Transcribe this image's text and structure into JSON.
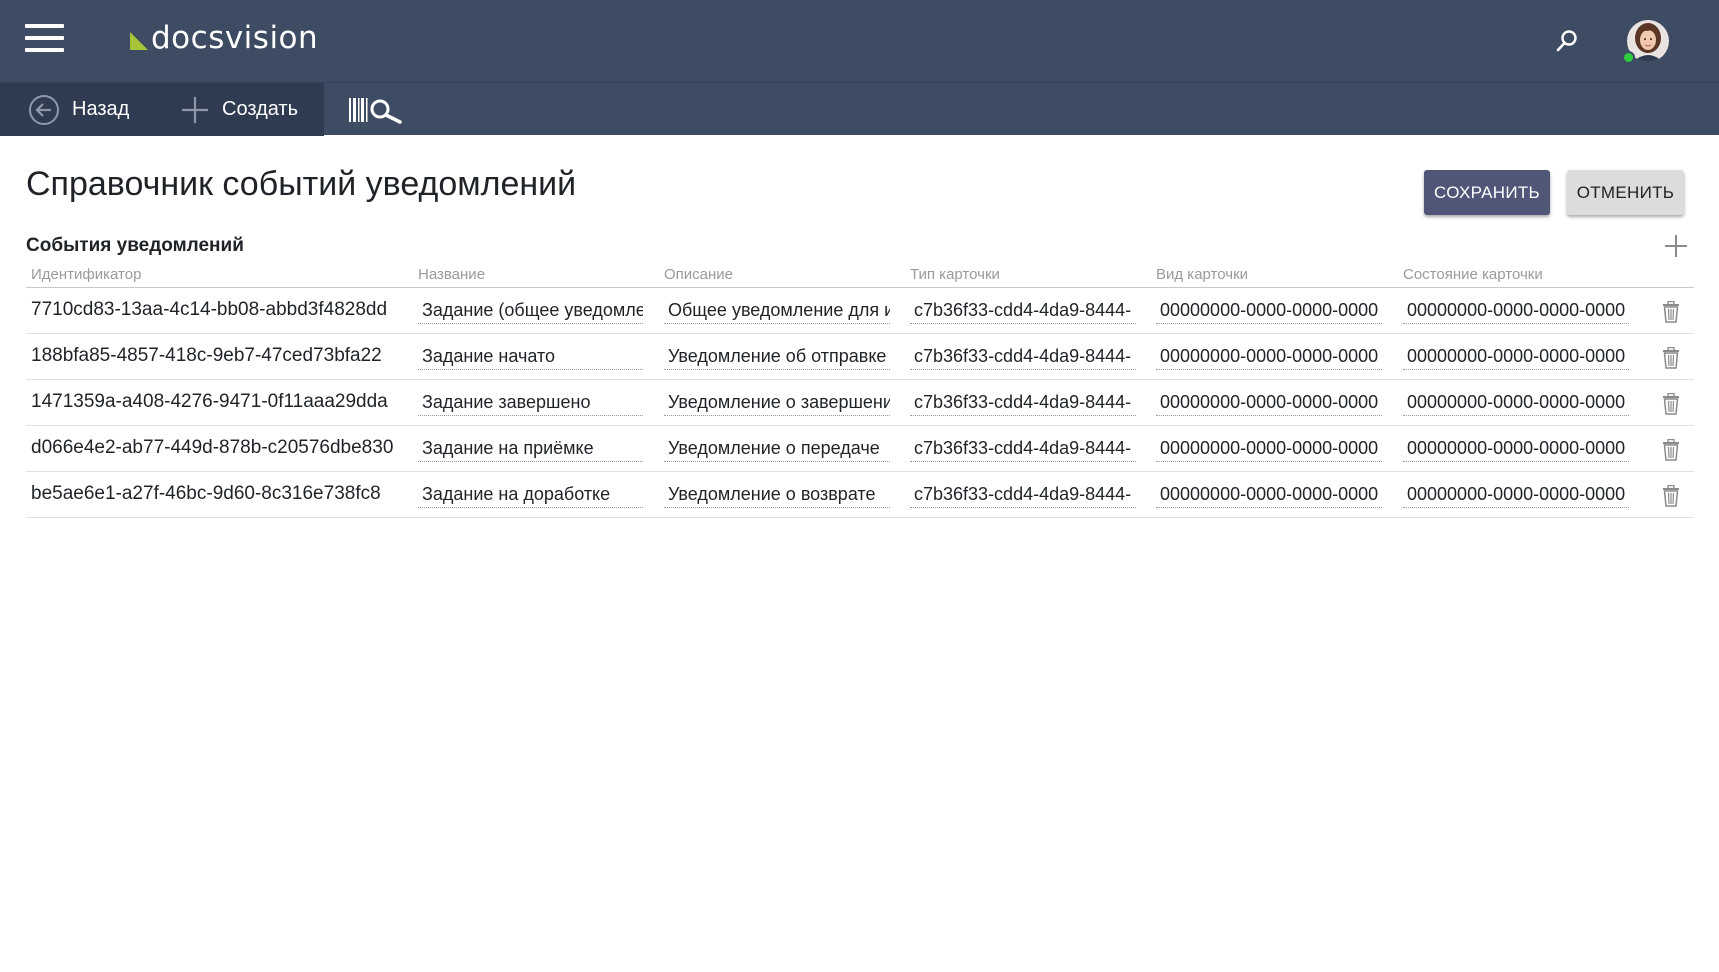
{
  "header": {
    "logo_text": "docsvision",
    "brand_color": "#a6c43a",
    "icons": [
      "menu-icon",
      "search-icon",
      "avatar"
    ]
  },
  "toolbar": {
    "back_label": "Назад",
    "create_label": "Создать",
    "barcode_icon": "barcode-search-icon"
  },
  "page": {
    "title": "Справочник событий уведомлений",
    "save_label": "СОХРАНИТЬ",
    "cancel_label": "ОТМЕНИТЬ"
  },
  "section": {
    "title": "События уведомлений"
  },
  "table": {
    "columns": [
      "Идентификатор",
      "Название",
      "Описание",
      "Тип карточки",
      "Вид карточки",
      "Состояние карточки"
    ],
    "rows": [
      {
        "id": "7710cd83-13aa-4c14-bb08-abbd3f4828dd",
        "name": "Задание (общее уведомление)",
        "description": "Общее уведомление для исполнителя",
        "card_type": "c7b36f33-cdd4-4da9-8444-",
        "card_kind": "00000000-0000-0000-0000",
        "card_state": "00000000-0000-0000-0000"
      },
      {
        "id": "188bfa85-4857-418c-9eb7-47ced73bfa22",
        "name": "Задание начато",
        "description": "Уведомление об отправке",
        "card_type": "c7b36f33-cdd4-4da9-8444-",
        "card_kind": "00000000-0000-0000-0000",
        "card_state": "00000000-0000-0000-0000"
      },
      {
        "id": "1471359a-a408-4276-9471-0f11aaa29dda",
        "name": "Задание завершено",
        "description": "Уведомление о завершении",
        "card_type": "c7b36f33-cdd4-4da9-8444-",
        "card_kind": "00000000-0000-0000-0000",
        "card_state": "00000000-0000-0000-0000"
      },
      {
        "id": "d066e4e2-ab77-449d-878b-c20576dbe830",
        "name": "Задание на приёмке",
        "description": "Уведомление о передаче",
        "card_type": "c7b36f33-cdd4-4da9-8444-",
        "card_kind": "00000000-0000-0000-0000",
        "card_state": "00000000-0000-0000-0000"
      },
      {
        "id": "be5ae6e1-a27f-46bc-9d60-8c316e738fc8",
        "name": "Задание на доработке",
        "description": "Уведомление о возврате",
        "card_type": "c7b36f33-cdd4-4da9-8444-",
        "card_kind": "00000000-0000-0000-0000",
        "card_state": "00000000-0000-0000-0000"
      }
    ]
  }
}
